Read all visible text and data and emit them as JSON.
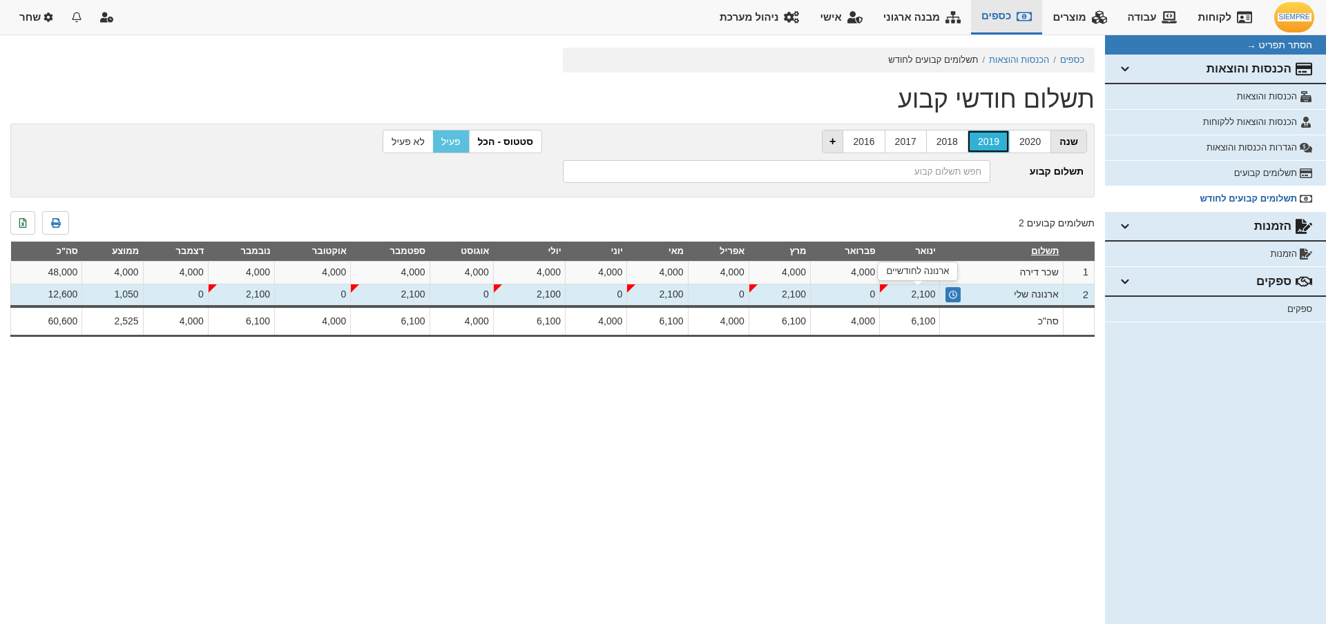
{
  "nav": {
    "logo_text": "SIEMPRE",
    "items": [
      {
        "label": "לקוחות",
        "selected": false
      },
      {
        "label": "עבודה",
        "selected": false
      },
      {
        "label": "מוצרים",
        "selected": false
      },
      {
        "label": "כספים",
        "selected": true
      },
      {
        "label": "מבנה ארגוני",
        "selected": false
      },
      {
        "label": "אישי",
        "selected": false
      },
      {
        "label": "ניהול מערכת",
        "selected": false
      }
    ],
    "user": {
      "label": "שחר"
    }
  },
  "sidebar": {
    "toggle": "הסתר תפריט →",
    "sections": [
      {
        "title": "הכנסות והוצאות",
        "expanded": true,
        "items": [
          {
            "label": "הכנסות והוצאות",
            "selected": false
          },
          {
            "label": "הכנסות והוצאות ללקוחות",
            "selected": false
          },
          {
            "label": "הגדרות הכנסות והוצאות",
            "selected": false
          },
          {
            "label": "תשלומים קבועים",
            "selected": false
          },
          {
            "label": "תשלומים קבועים לחודש",
            "selected": true
          }
        ]
      },
      {
        "title": "הזמנות",
        "expanded": true,
        "items": [
          {
            "label": "הזמנות",
            "selected": false
          }
        ]
      },
      {
        "title": "ספקים",
        "expanded": true,
        "items": [
          {
            "label": "ספקים",
            "selected": false
          }
        ]
      }
    ]
  },
  "breadcrumb": {
    "separator": "/",
    "items": [
      {
        "label": "כספים",
        "current": false
      },
      {
        "label": "הכנסות והוצאות",
        "current": false
      },
      {
        "label": "תשלומים קבועים לחודש",
        "current": true
      }
    ]
  },
  "title": "תשלום חודשי קבוע",
  "filters": {
    "year": {
      "label": "שנה",
      "add": "+",
      "options": [
        {
          "label": "2020",
          "selected": false
        },
        {
          "label": "2019",
          "selected": true
        },
        {
          "label": "2018",
          "selected": false
        },
        {
          "label": "2017",
          "selected": false
        },
        {
          "label": "2016",
          "selected": false
        }
      ]
    },
    "status": {
      "label": "סטטוס - הכל",
      "options": [
        {
          "label": "פעיל",
          "selected": true
        },
        {
          "label": "לא פעיל",
          "selected": false
        }
      ]
    },
    "search": {
      "label": "תשלום קבוע",
      "placeholder": "חפש תשלום קבוע"
    }
  },
  "count": "תשלומים קבועים 2",
  "table": {
    "columns": [
      "תשלום",
      "ינואר",
      "פברואר",
      "מרץ",
      "אפריל",
      "מאי",
      "יוני",
      "יולי",
      "אוגוסט",
      "ספטמבר",
      "אוקטובר",
      "נובמבר",
      "דצמבר",
      "ממוצע",
      "סה\"כ"
    ],
    "rows": [
      {
        "index": "1",
        "selected": false,
        "schedule_button": false,
        "cells": [
          {
            "value": "שכר דירה"
          },
          {},
          {
            "value": "4,000",
            "flag": false
          },
          {
            "value": "4,000",
            "flag": false
          },
          {
            "value": "4,000",
            "flag": false
          },
          {
            "value": "4,000",
            "flag": false
          },
          {
            "value": "4,000",
            "flag": false
          },
          {
            "value": "4,000",
            "flag": false
          },
          {
            "value": "4,000",
            "flag": false
          },
          {
            "value": "4,000",
            "flag": false
          },
          {
            "value": "4,000",
            "flag": false
          },
          {
            "value": "4,000",
            "flag": false
          },
          {
            "value": "4,000",
            "flag": false
          },
          {
            "value": "4,000",
            "flag": false
          },
          {
            "value": "48,000",
            "flag": false
          }
        ]
      },
      {
        "index": "2",
        "selected": true,
        "schedule_button": true,
        "cells": [
          {
            "value": "ארנונה שלי"
          },
          {
            "value": "2,100",
            "flag": true,
            "tooltip": "ארנונה לחודשיים"
          },
          {
            "value": "0",
            "flag": false
          },
          {
            "value": "2,100",
            "flag": true
          },
          {
            "value": "0",
            "flag": false
          },
          {
            "value": "2,100",
            "flag": true
          },
          {
            "value": "0",
            "flag": false
          },
          {
            "value": "2,100",
            "flag": true
          },
          {
            "value": "0",
            "flag": false
          },
          {
            "value": "2,100",
            "flag": true
          },
          {
            "value": "0",
            "flag": false
          },
          {
            "value": "2,100",
            "flag": true
          },
          {
            "value": "0",
            "flag": false
          },
          {
            "value": "1,050",
            "flag": false
          },
          {
            "value": "12,600",
            "flag": false
          }
        ]
      }
    ],
    "totals": {
      "cells": [
        "סה\"כ",
        "6,100",
        "4,000",
        "6,100",
        "4,000",
        "6,100",
        "4,000",
        "6,100",
        "4,000",
        "6,100",
        "4,000",
        "6,100",
        "4,000",
        "2,525",
        "60,600"
      ]
    }
  }
}
